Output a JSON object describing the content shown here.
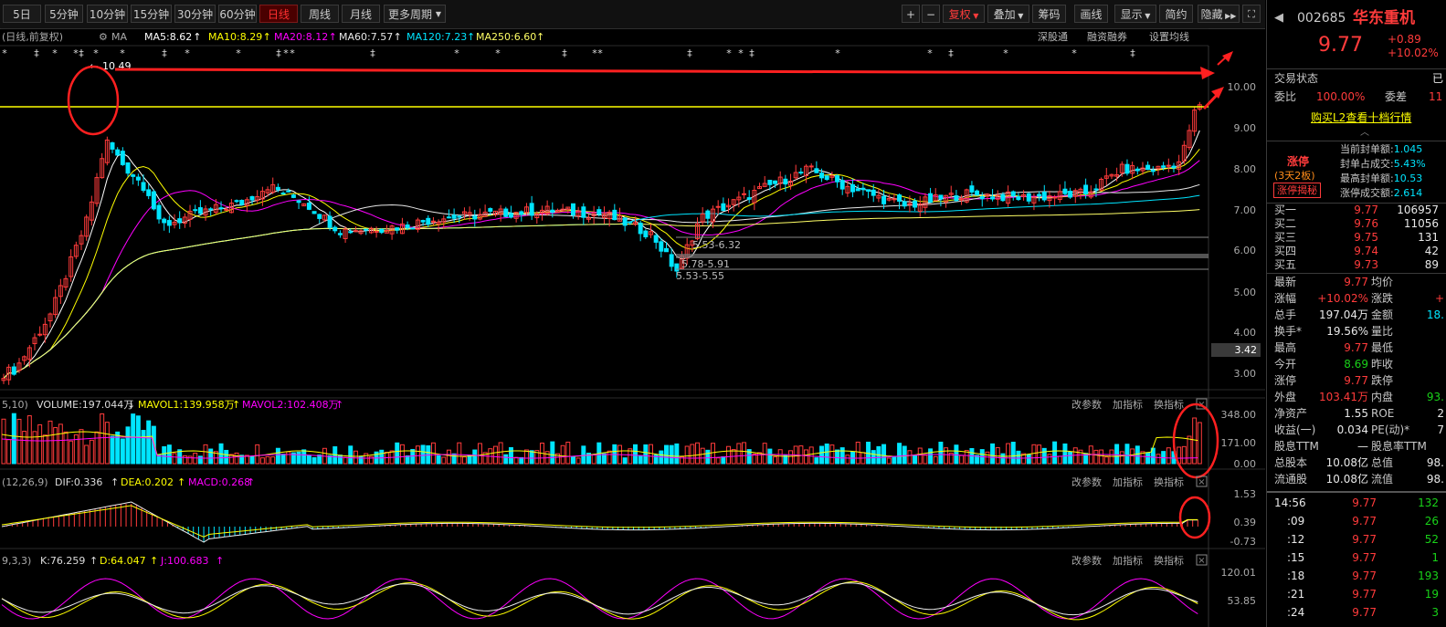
{
  "toolbar": {
    "period_tabs": [
      "5日",
      "5分钟",
      "10分钟",
      "15分钟",
      "30分钟",
      "60分钟",
      "日线",
      "周线",
      "月线",
      "更多周期"
    ],
    "active_tab": "日线",
    "right_tools": [
      "+",
      "−",
      "复权",
      "叠加",
      "筹码",
      "画线",
      "显示",
      "简约",
      "隐藏"
    ],
    "active_tool": "复权"
  },
  "main_chart": {
    "header_prefix": "(日线,前复权)",
    "ma_labels": [
      {
        "text": "MA5:8.62",
        "color": "#ffffff"
      },
      {
        "text": "MA10:8.29",
        "color": "#ffff00"
      },
      {
        "text": "MA20:8.12",
        "color": "#ff00ff"
      },
      {
        "text": "MA60:7.57",
        "color": "#e8e8e8"
      },
      {
        "text": "MA120:7.23",
        "color": "#00e5ff"
      },
      {
        "text": "MA250:6.60",
        "color": "#ffff66"
      }
    ],
    "header_links": [
      "深股通",
      "融资融券",
      "设置均线"
    ],
    "y_ticks": [
      "10.00",
      "9.00",
      "8.00",
      "7.00",
      "6.00",
      "5.00",
      "4.00",
      "3.00"
    ],
    "price_tag": "3.42",
    "annotations": [
      "10.49",
      "5.53-6.32",
      "5.78-5.91",
      "5.53-5.55"
    ]
  },
  "volume_panel": {
    "label_prefix": "5,10)",
    "volume": "VOLUME:197.044万",
    "mavol1": "MAVOL1:139.958万",
    "mavol2": "MAVOL2:102.408万",
    "y_ticks": [
      "348.00",
      "171.00",
      "0.00"
    ],
    "actions": [
      "改参数",
      "加指标",
      "换指标"
    ]
  },
  "macd_panel": {
    "label_prefix": "(12,26,9)",
    "dif": "DIF:0.336",
    "dea": "DEA:0.202",
    "macd": "MACD:0.268",
    "y_ticks": [
      "1.53",
      "0.39",
      "-0.73"
    ],
    "actions": [
      "改参数",
      "加指标",
      "换指标"
    ]
  },
  "kdj_panel": {
    "label_prefix": "9,3,3)",
    "k": "K:76.259",
    "d": "D:64.047",
    "j": "J:100.683",
    "y_ticks": [
      "120.01",
      "53.85"
    ],
    "actions": [
      "改参数",
      "加指标",
      "换指标"
    ]
  },
  "stock": {
    "code": "002685",
    "name": "华东重机",
    "price": "9.77",
    "change": "+0.89",
    "change_pct": "+10.02%",
    "trade_status_label": "交易状态",
    "trade_status_value": "已",
    "weibi_label": "委比",
    "weibi_value": "100.00%",
    "weicha_label": "委差",
    "weicha_value": "11",
    "l2_link": "购买L2查看十档行情",
    "limit_title": "涨停",
    "limit_sub": "(3天2板)",
    "limit_btn": "涨停揭秘",
    "limit_stats": [
      {
        "label": "当前封单额:",
        "value": "1.045"
      },
      {
        "label": "封单占成交:",
        "value": "5.43%"
      },
      {
        "label": "最高封单额:",
        "value": "10.53"
      },
      {
        "label": "涨停成交额:",
        "value": "2.614"
      }
    ],
    "bids": [
      {
        "label": "买一",
        "price": "9.77",
        "vol": "106957"
      },
      {
        "label": "买二",
        "price": "9.76",
        "vol": "11056"
      },
      {
        "label": "买三",
        "price": "9.75",
        "vol": "131"
      },
      {
        "label": "买四",
        "price": "9.74",
        "vol": "42"
      },
      {
        "label": "买五",
        "price": "9.73",
        "vol": "89"
      }
    ],
    "stats": [
      {
        "l1": "最新",
        "v1": "9.77",
        "c1": "red",
        "l2": "均价",
        "v2": "",
        "c2": "white"
      },
      {
        "l1": "涨幅",
        "v1": "+10.02%",
        "c1": "red",
        "l2": "涨跌",
        "v2": "+",
        "c2": "red"
      },
      {
        "l1": "总手",
        "v1": "197.04万",
        "c1": "white",
        "l2": "金额",
        "v2": "18.",
        "c2": "cyan"
      },
      {
        "l1": "换手*",
        "v1": "19.56%",
        "c1": "white",
        "l2": "量比",
        "v2": "",
        "c2": "white"
      },
      {
        "l1": "最高",
        "v1": "9.77",
        "c1": "red",
        "l2": "最低",
        "v2": "",
        "c2": "white"
      },
      {
        "l1": "今开",
        "v1": "8.69",
        "c1": "green",
        "l2": "昨收",
        "v2": "",
        "c2": "white"
      },
      {
        "l1": "涨停",
        "v1": "9.77",
        "c1": "red",
        "l2": "跌停",
        "v2": "",
        "c2": "white"
      },
      {
        "l1": "外盘",
        "v1": "103.41万",
        "c1": "red",
        "l2": "内盘",
        "v2": "93.",
        "c2": "green"
      },
      {
        "l1": "净资产",
        "v1": "1.55",
        "c1": "white",
        "l2": "ROE",
        "v2": "2",
        "c2": "white"
      },
      {
        "l1": "收益(一)",
        "v1": "0.034",
        "c1": "white",
        "l2": "PE(动)*",
        "v2": "7",
        "c2": "white"
      },
      {
        "l1": "股息TTM",
        "v1": "—",
        "c1": "white",
        "l2": "股息率TTM",
        "v2": "",
        "c2": "white"
      },
      {
        "l1": "总股本",
        "v1": "10.08亿",
        "c1": "white",
        "l2": "总值",
        "v2": "98.",
        "c2": "white"
      },
      {
        "l1": "流通股",
        "v1": "10.08亿",
        "c1": "white",
        "l2": "流值",
        "v2": "98.",
        "c2": "white"
      }
    ],
    "ticks": [
      {
        "time": "14:56",
        "price": "9.77",
        "vol": "132"
      },
      {
        "time": ":09",
        "price": "9.77",
        "vol": "26"
      },
      {
        "time": ":12",
        "price": "9.77",
        "vol": "52"
      },
      {
        "time": ":15",
        "price": "9.77",
        "vol": "1"
      },
      {
        "time": ":18",
        "price": "9.77",
        "vol": "193"
      },
      {
        "time": ":21",
        "price": "9.77",
        "vol": "19"
      },
      {
        "time": ":24",
        "price": "9.77",
        "vol": "3"
      }
    ]
  },
  "colors": {
    "up": "#ff3b3b",
    "down": "#00e5ff",
    "ma5": "#ffffff",
    "ma10": "#ffff00",
    "ma20": "#ff00ff",
    "ma60": "#e8e8e8",
    "ma120": "#00e5ff",
    "ma250": "#ffff66",
    "resistance": "#ffff00",
    "markup": "#ff2020"
  }
}
